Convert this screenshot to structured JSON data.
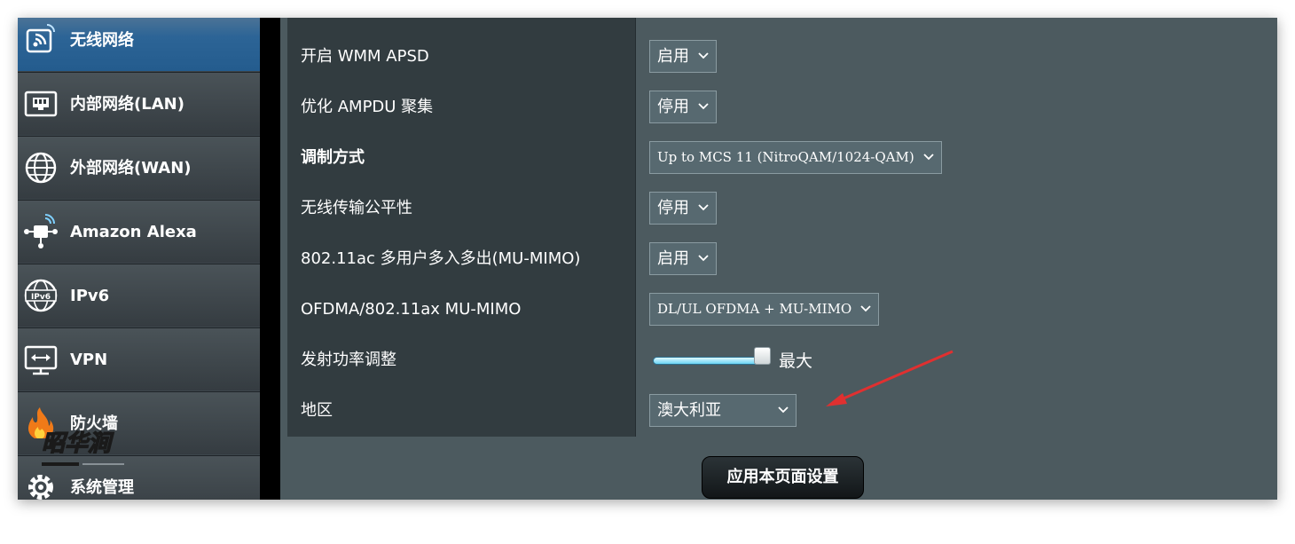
{
  "sidebar": {
    "items": [
      {
        "label": "无线网络",
        "icon": "wireless-icon",
        "active": true
      },
      {
        "label": "内部网络(LAN)",
        "icon": "lan-icon"
      },
      {
        "label": "外部网络(WAN)",
        "icon": "globe-icon"
      },
      {
        "label": "Amazon Alexa",
        "icon": "alexa-icon"
      },
      {
        "label": "IPv6",
        "icon": "ipv6-icon"
      },
      {
        "label": "VPN",
        "icon": "vpn-icon"
      },
      {
        "label": "防火墙",
        "icon": "firewall-icon"
      },
      {
        "label": "系统管理",
        "icon": "gear-icon"
      }
    ]
  },
  "settings": {
    "rows": [
      {
        "label": "开启 WMM APSD",
        "value": "启用"
      },
      {
        "label": "优化 AMPDU 聚集",
        "value": "停用"
      },
      {
        "label": "调制方式",
        "value": "Up to MCS 11 (NitroQAM/1024-QAM)"
      },
      {
        "label": "无线传输公平性",
        "value": "停用"
      },
      {
        "label": "802.11ac 多用户多入多出(MU-MIMO)",
        "value": "启用"
      },
      {
        "label": "OFDMA/802.11ax MU-MIMO",
        "value": "DL/UL OFDMA + MU-MIMO"
      },
      {
        "label": "发射功率调整",
        "value": "最大",
        "level": 1.0
      },
      {
        "label": "地区",
        "value": "澳大利亚"
      }
    ]
  },
  "apply_label": "应用本页面设置",
  "watermark": "昭华涧",
  "colors": {
    "accent_active": "#2c6496",
    "annotation_arrow": "#e03030",
    "slider_fill": "#6ad4f4"
  }
}
